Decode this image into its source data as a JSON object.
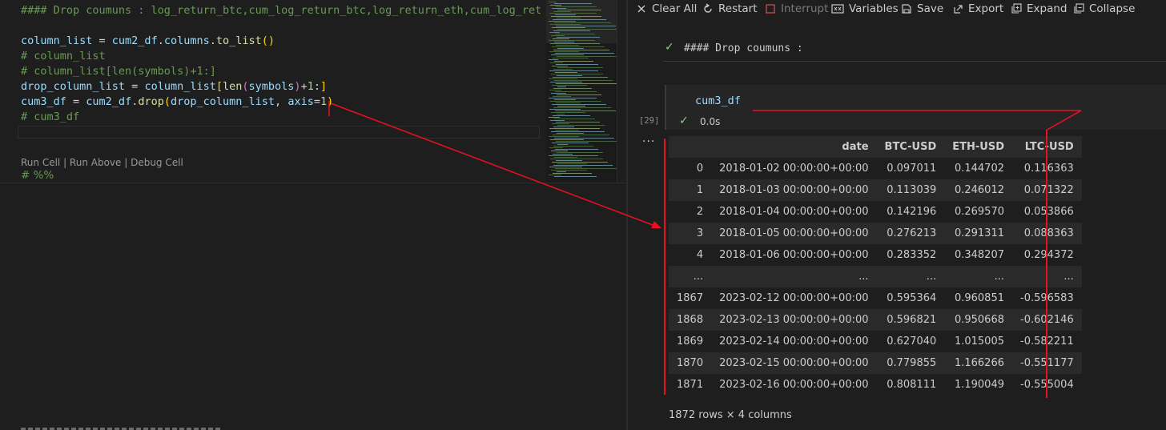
{
  "editor": {
    "lines": [
      {
        "segments": [
          {
            "t": "#### Drop coumuns : log_return_btc,cum_log_return_btc,log_return_eth,cum_log_return_e",
            "c": "c-com"
          }
        ]
      },
      {
        "segments": []
      },
      {
        "segments": [
          {
            "t": "column_list",
            "c": "c-var"
          },
          {
            "t": " = ",
            "c": "c-op"
          },
          {
            "t": "cum2_df",
            "c": "c-var"
          },
          {
            "t": ".",
            "c": "c-op"
          },
          {
            "t": "columns",
            "c": "c-var"
          },
          {
            "t": ".",
            "c": "c-op"
          },
          {
            "t": "to_list",
            "c": "c-fn"
          },
          {
            "t": "()",
            "c": "c-b1"
          }
        ]
      },
      {
        "segments": [
          {
            "t": "# column_list",
            "c": "c-com"
          }
        ]
      },
      {
        "segments": [
          {
            "t": "# column_list[len(symbols)+1:]",
            "c": "c-com"
          }
        ]
      },
      {
        "segments": [
          {
            "t": "drop_column_list",
            "c": "c-var"
          },
          {
            "t": " = ",
            "c": "c-op"
          },
          {
            "t": "column_list",
            "c": "c-var"
          },
          {
            "t": "[",
            "c": "c-b1"
          },
          {
            "t": "len",
            "c": "c-fn"
          },
          {
            "t": "(",
            "c": "c-b2"
          },
          {
            "t": "symbols",
            "c": "c-var"
          },
          {
            "t": ")",
            "c": "c-b2"
          },
          {
            "t": "+",
            "c": "c-op"
          },
          {
            "t": "1",
            "c": "c-num"
          },
          {
            "t": ":",
            "c": "c-op"
          },
          {
            "t": "]",
            "c": "c-b1"
          }
        ]
      },
      {
        "segments": [
          {
            "t": "cum3_df",
            "c": "c-var"
          },
          {
            "t": " = ",
            "c": "c-op"
          },
          {
            "t": "cum2_df",
            "c": "c-var"
          },
          {
            "t": ".",
            "c": "c-op"
          },
          {
            "t": "drop",
            "c": "c-fn"
          },
          {
            "t": "(",
            "c": "c-b1"
          },
          {
            "t": "drop_column_list",
            "c": "c-var"
          },
          {
            "t": ", ",
            "c": "c-op"
          },
          {
            "t": "axis",
            "c": "c-var"
          },
          {
            "t": "=",
            "c": "c-op"
          },
          {
            "t": "1",
            "c": "c-num"
          },
          {
            "t": ")",
            "c": "c-b1"
          }
        ]
      },
      {
        "segments": [
          {
            "t": "# cum3_df",
            "c": "c-com"
          }
        ]
      }
    ],
    "codelens": "Run Cell | Run Above | Debug Cell",
    "next_cell_marker": "# %%"
  },
  "toolbar": {
    "clear_all": "Clear All",
    "restart": "Restart",
    "interrupt": "Interrupt",
    "variables": "Variables",
    "save": "Save",
    "export": "Export",
    "expand": "Expand",
    "collapse": "Collapse"
  },
  "markdown_cell": {
    "text": "#### Drop coumuns :"
  },
  "code_cell": {
    "input": "cum3_df",
    "execution_count": "[29]",
    "duration": "0.0s",
    "output_marker": "..."
  },
  "dataframe": {
    "columns": [
      "",
      "date",
      "BTC-USD",
      "ETH-USD",
      "LTC-USD"
    ],
    "rows": [
      [
        "0",
        "2018-01-02 00:00:00+00:00",
        "0.097011",
        "0.144702",
        "0.116363"
      ],
      [
        "1",
        "2018-01-03 00:00:00+00:00",
        "0.113039",
        "0.246012",
        "0.071322"
      ],
      [
        "2",
        "2018-01-04 00:00:00+00:00",
        "0.142196",
        "0.269570",
        "0.053866"
      ],
      [
        "3",
        "2018-01-05 00:00:00+00:00",
        "0.276213",
        "0.291311",
        "0.088363"
      ],
      [
        "4",
        "2018-01-06 00:00:00+00:00",
        "0.283352",
        "0.348207",
        "0.294372"
      ],
      [
        "...",
        "...",
        "...",
        "...",
        "..."
      ],
      [
        "1867",
        "2023-02-12 00:00:00+00:00",
        "0.595364",
        "0.960851",
        "-0.596583"
      ],
      [
        "1868",
        "2023-02-13 00:00:00+00:00",
        "0.596821",
        "0.950668",
        "-0.602146"
      ],
      [
        "1869",
        "2023-02-14 00:00:00+00:00",
        "0.627040",
        "1.015005",
        "-0.582211"
      ],
      [
        "1870",
        "2023-02-15 00:00:00+00:00",
        "0.779855",
        "1.166266",
        "-0.551177"
      ],
      [
        "1871",
        "2023-02-16 00:00:00+00:00",
        "0.808111",
        "1.190049",
        "-0.555004"
      ]
    ],
    "shape": "1872 rows × 4 columns"
  },
  "colors": {
    "annotation_red": "#e81123",
    "success_green": "#89d185",
    "comment_green": "#6a9955"
  }
}
